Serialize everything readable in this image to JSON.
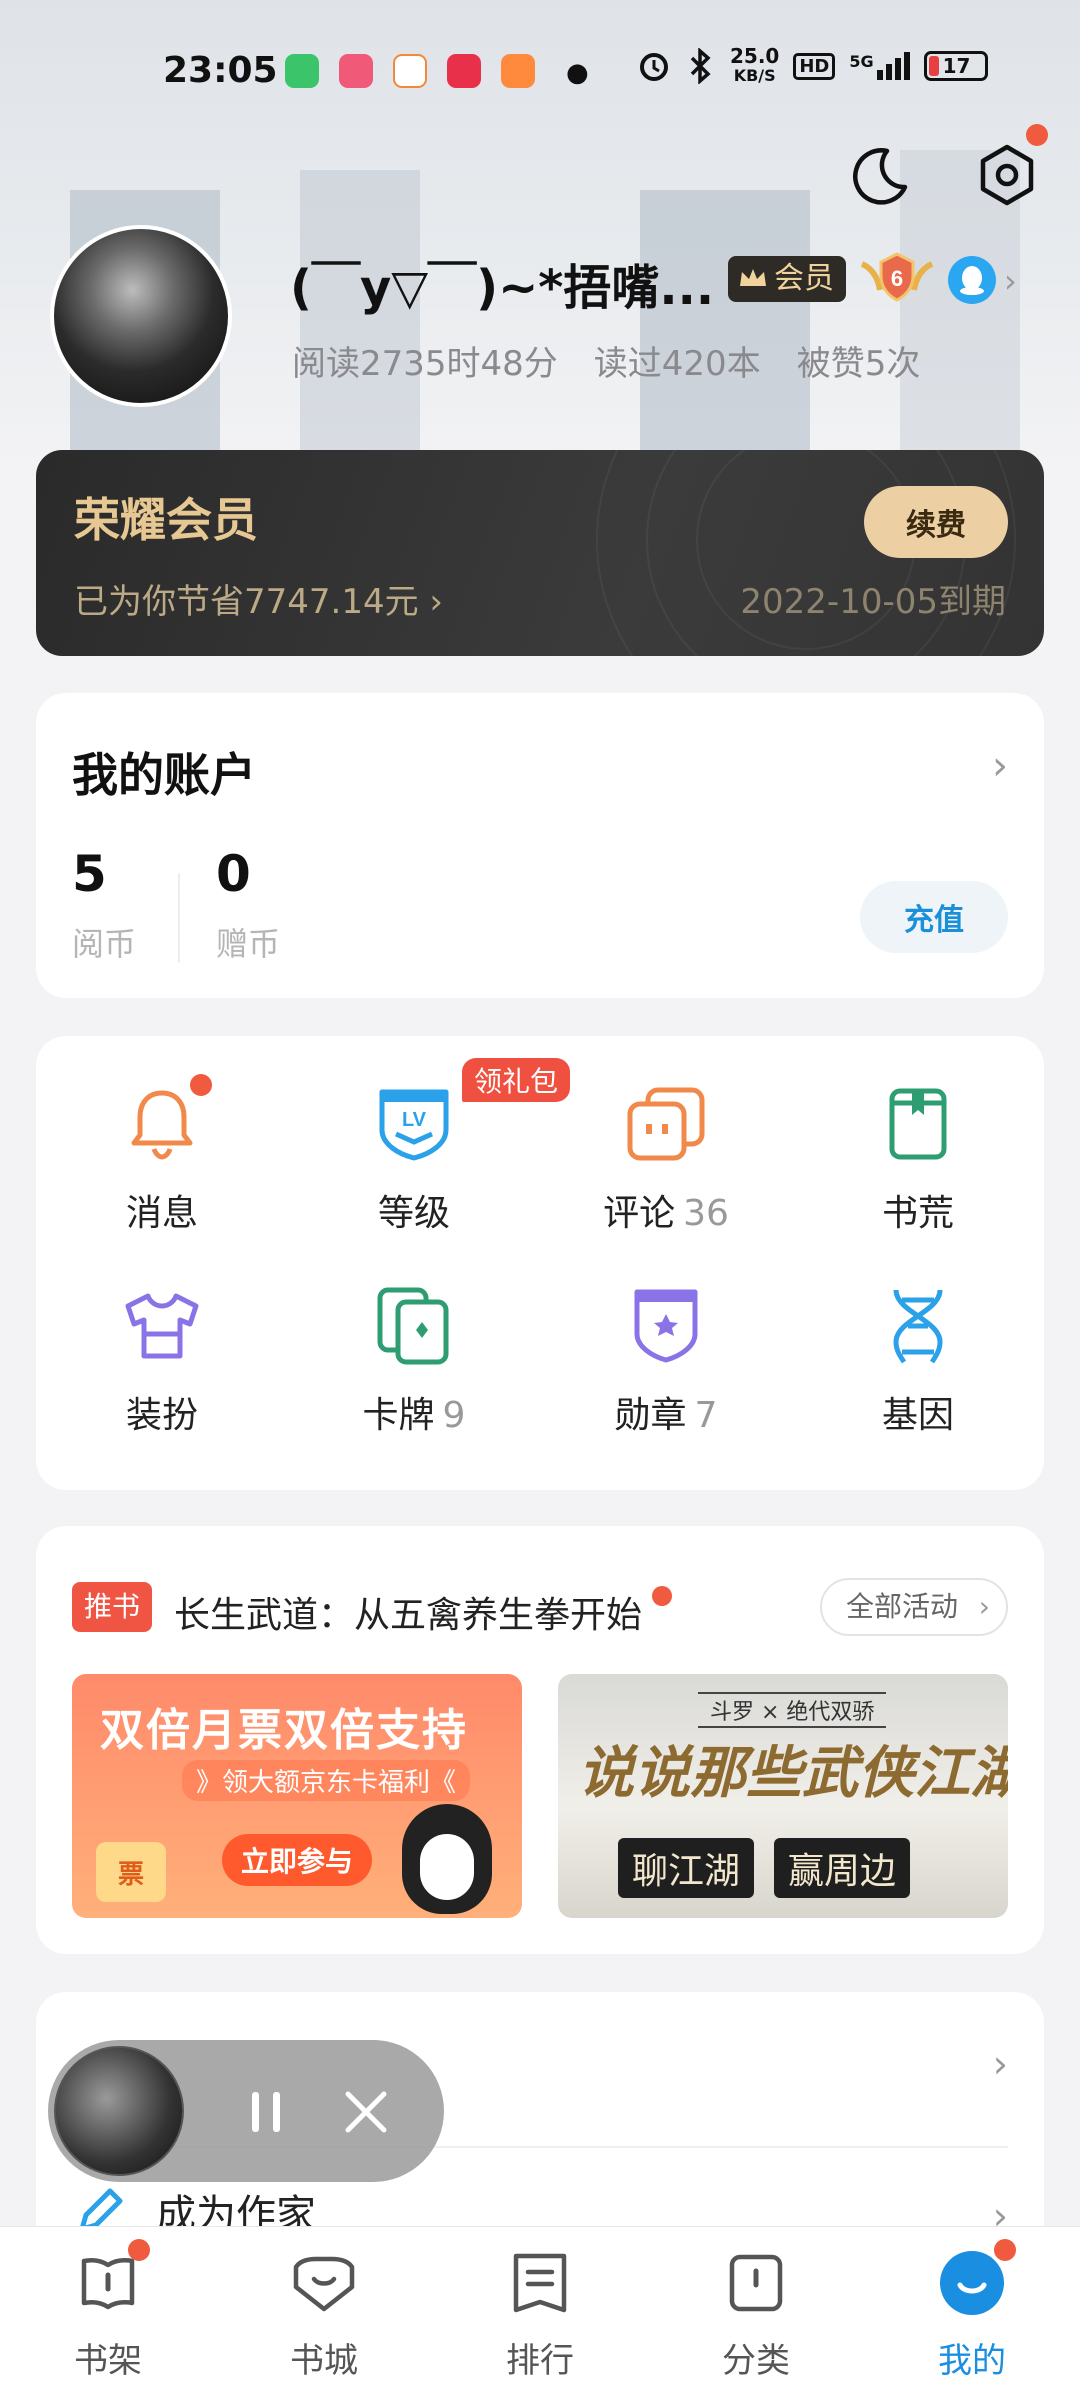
{
  "status_bar": {
    "time": "23:05",
    "net_speed_value": "25.0",
    "net_speed_unit": "KB/S",
    "hd": "HD",
    "signal": "5G",
    "battery": "17"
  },
  "profile": {
    "username": "(￣y▽￣)~*捂嘴...",
    "vip_badge": "会员",
    "level": "6",
    "stats": {
      "reading_time": "阅读2735时48分",
      "books_read": "读过420本",
      "likes": "被赞5次"
    }
  },
  "vip_card": {
    "title": "荣耀会员",
    "savings": "已为你节省7747.14元 ›",
    "expiry": "2022-10-05到期",
    "renew_label": "续费"
  },
  "account": {
    "title": "我的账户",
    "coins": [
      {
        "value": "5",
        "label": "阅币"
      },
      {
        "value": "0",
        "label": "赠币"
      }
    ],
    "recharge_label": "充值"
  },
  "grid": {
    "gift_tag": "领礼包",
    "items": [
      {
        "label": "消息",
        "count": "",
        "icon": "bell-icon"
      },
      {
        "label": "等级",
        "count": "",
        "icon": "level-shield-icon"
      },
      {
        "label": "评论",
        "count": "36",
        "icon": "comment-icon"
      },
      {
        "label": "书荒",
        "count": "",
        "icon": "book-icon"
      },
      {
        "label": "装扮",
        "count": "",
        "icon": "tshirt-icon"
      },
      {
        "label": "卡牌",
        "count": "9",
        "icon": "cards-icon"
      },
      {
        "label": "勋章",
        "count": "7",
        "icon": "medal-icon"
      },
      {
        "label": "基因",
        "count": "",
        "icon": "dna-icon"
      }
    ]
  },
  "promo": {
    "tag": "推书",
    "title": "长生武道：从五禽养生拳开始",
    "all_activities": "全部活动",
    "banner1": {
      "headline": "双倍月票双倍支持",
      "sub": "》领大额京东卡福利《",
      "cta": "立即参与",
      "ticket": "票"
    },
    "banner2": {
      "tag": "斗罗 × 绝代双骄",
      "calligraphy": "说说那些武侠江湖",
      "left": "聊江湖",
      "right": "赢周边"
    }
  },
  "misc": {
    "become_author": "成为作家"
  },
  "bottom_nav": [
    {
      "label": "书架",
      "icon": "bookshelf-icon",
      "active": false
    },
    {
      "label": "书城",
      "icon": "bookstore-icon",
      "active": false
    },
    {
      "label": "排行",
      "icon": "ranking-icon",
      "active": false
    },
    {
      "label": "分类",
      "icon": "category-icon",
      "active": false
    },
    {
      "label": "我的",
      "icon": "me-icon",
      "active": true
    }
  ],
  "colors": {
    "accent_blue": "#1a8ee0",
    "badge_red": "#f05a3e",
    "vip_gold": "#e7c892",
    "orange_icon": "#f0894a",
    "blue_icon": "#2aa1e8",
    "green_icon": "#2e9e72",
    "purple_icon": "#8a73e6"
  }
}
